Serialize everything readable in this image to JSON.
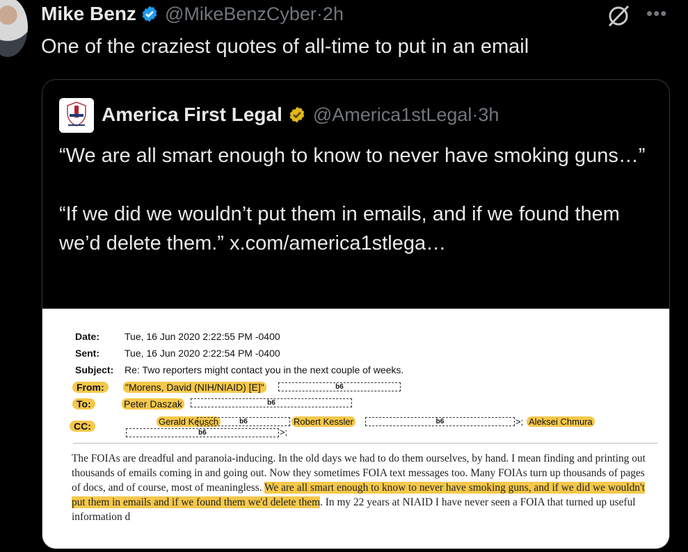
{
  "tweet": {
    "author_name": "Mike Benz",
    "author_handle": "@MikeBenzCyber",
    "time_sep": " · ",
    "time": "2h",
    "text": "One of the craziest quotes of all-time to put in an email",
    "more_label": "•••"
  },
  "quote": {
    "author_name": "America First Legal",
    "author_handle": "@America1stLegal",
    "time_sep": " · ",
    "time": "3h",
    "line1": "“We are all smart enough to know to never have smoking guns…”",
    "line2": "“If we did we wouldn’t put them in emails, and if we found them we’d delete them.”  x.com/america1stlega…"
  },
  "email": {
    "date_label": "Date:",
    "date_value": "Tue, 16 Jun 2020 2:22:55 PM -0400",
    "sent_label": "Sent:",
    "sent_value": "Tue, 16 Jun 2020 2:22:54 PM -0400",
    "subject_label": "Subject:",
    "subject_value": "Re: Two reporters might contact you in the next couple of weeks.",
    "from_label": "From:",
    "from_value": "\"Morens, David (NIH/NIAID) [E]\"",
    "to_label": "To:",
    "to_value": "Peter Daszak",
    "cc_label": "CC:",
    "cc_1": "Gerald Keusch",
    "cc_2": "Robert Kessler",
    "cc_3": "Aleksei Chmura",
    "redaction": "b6",
    "trail": ">;",
    "body_plain": "The FOIAs are dreadful and paranoia-inducing.  In the old days we had to do them ourselves, by hand.  I mean finding and printing out thousands of emails coming in and going out.  Now they sometimes FOIA text messages too.  Many FOIAs turn up thousands of pages of docs, and of course, most of meaningless. ",
    "body_highlight": "We are all smart enough to know to never have smoking guns, and if we did we wouldn't put them in emails and if we found them we'd delete them",
    "body_end": ".  In my 22 years at NIAID I have never seen a FOIA that turned up useful information   d"
  },
  "colors": {
    "background": "#000000",
    "text": "#e7e9ea",
    "muted": "#71767b",
    "verified_blue": "#1d9bf0",
    "verified_gold": "#e2b719",
    "highlight": "#f5c84b"
  }
}
